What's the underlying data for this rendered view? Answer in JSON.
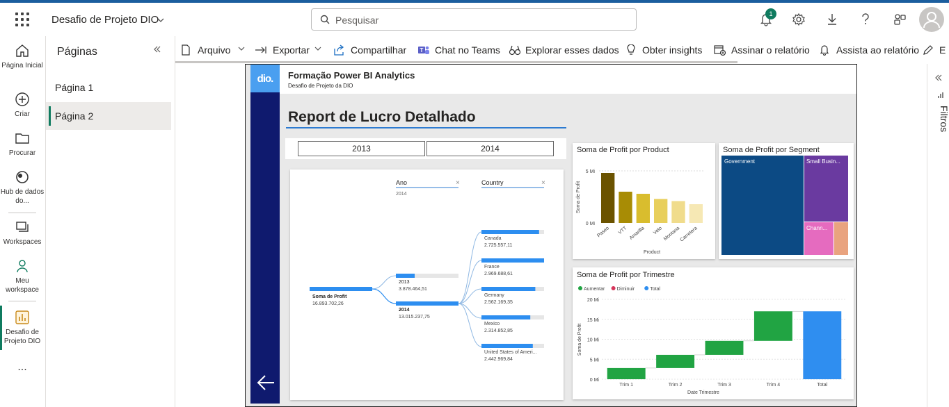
{
  "header": {
    "workspace_title": "Desafio de Projeto DIO",
    "search_placeholder": "Pesquisar",
    "notification_count": "1"
  },
  "rail": {
    "items": [
      {
        "label": "Página Inicial",
        "icon": "home-icon"
      },
      {
        "label": "Criar",
        "icon": "plus-circle-icon"
      },
      {
        "label": "Procurar",
        "icon": "folder-icon"
      },
      {
        "label": "Hub de dados do...",
        "icon": "data-hub-icon"
      },
      {
        "label": "Workspaces",
        "icon": "workspaces-icon"
      },
      {
        "label": "Meu workspace",
        "icon": "person-icon"
      },
      {
        "label": "Desafio de Projeto DIO",
        "icon": "report-icon"
      }
    ],
    "more": "..."
  },
  "pages_pane": {
    "title": "Páginas",
    "items": [
      "Página 1",
      "Página 2"
    ],
    "selected": "Página 2"
  },
  "toolbar": {
    "items": [
      {
        "label": "Arquivo",
        "icon": "file-icon"
      },
      {
        "label": "Exportar",
        "icon": "export-icon"
      },
      {
        "label": "Compartilhar",
        "icon": "share-icon"
      },
      {
        "label": "Chat no Teams",
        "icon": "teams-icon"
      },
      {
        "label": "Explorar esses dados",
        "icon": "binoculars-icon"
      },
      {
        "label": "Obter insights",
        "icon": "lightbulb-icon"
      },
      {
        "label": "Assinar o relatório",
        "icon": "subscribe-icon"
      },
      {
        "label": "Assista ao relatório",
        "icon": "bell-icon"
      },
      {
        "label": "E",
        "icon": "pencil-icon"
      }
    ]
  },
  "filters_pane": {
    "label": "Filtros"
  },
  "report": {
    "logo_text": "dio.",
    "header_title": "Formação Power BI Analytics",
    "header_subtitle": "Desafio de Projeto da DIO",
    "title": "Report de Lucro Detalhado",
    "slicer": [
      "2013",
      "2014"
    ],
    "decomposition": {
      "filter1_label": "Ano",
      "filter1_value": "2014",
      "filter2_label": "Country",
      "root": {
        "label": "Soma de Profit",
        "value": "16.893.702,26"
      },
      "years": [
        {
          "label": "2013",
          "value": "3.878.464,51",
          "fill": 0.3
        },
        {
          "label": "2014",
          "value": "13.015.237,75",
          "fill": 1.0
        }
      ],
      "countries": [
        {
          "label": "Canada",
          "value": "2.725.557,11",
          "fill": 0.92
        },
        {
          "label": "France",
          "value": "2.969.688,61",
          "fill": 1.0
        },
        {
          "label": "Germany",
          "value": "2.562.169,35",
          "fill": 0.86
        },
        {
          "label": "Mexico",
          "value": "2.314.852,85",
          "fill": 0.78
        },
        {
          "label": "United States of Ameri...",
          "value": "2.442.969,84",
          "fill": 0.82
        }
      ]
    },
    "product_chart": {
      "title": "Soma de Profit por Product",
      "type": "bar",
      "ylabel": "Soma de Profit",
      "xlabel": "Product",
      "yticks": [
        "5 Mi",
        "0 Mi"
      ],
      "categories": [
        "Paseo",
        "VTT",
        "Amarilla",
        "Velo",
        "Montana",
        "Carretera"
      ],
      "values": [
        4.8,
        3.0,
        2.8,
        2.3,
        2.1,
        1.8
      ],
      "ylim": [
        0,
        5
      ],
      "colors": [
        "#6b5300",
        "#a88c05",
        "#d9bd2e",
        "#e8cf5c",
        "#f0dc8c",
        "#f6e8b4"
      ]
    },
    "segment_chart": {
      "title": "Soma de Profit por Segment",
      "segments": [
        {
          "label": "Government",
          "color": "#0c4a84"
        },
        {
          "label": "Small Busin...",
          "color": "#6a3aa0"
        },
        {
          "label": "Chann...",
          "color": "#e56bbf"
        },
        {
          "label": "",
          "color": "#e9a37f"
        }
      ]
    },
    "quarter_chart": {
      "title": "Soma de Profit por Trimestre",
      "type": "waterfall",
      "legend": [
        "Aumentar",
        "Diminuir",
        "Total"
      ],
      "legend_colors": [
        "#21a443",
        "#d6365b",
        "#2f8ef0"
      ],
      "ylabel": "Soma de Profit",
      "xlabel": "Date Trimestre",
      "yticks": [
        "20 Mi",
        "15 Mi",
        "10 Mi",
        "5 Mi",
        "0 Mi"
      ],
      "ylim": [
        0,
        20
      ],
      "categories": [
        "Trim 1",
        "Trim 2",
        "Trim 3",
        "Trim 4",
        "Total"
      ],
      "values": [
        2.8,
        3.3,
        3.5,
        7.4,
        17.0
      ]
    }
  }
}
